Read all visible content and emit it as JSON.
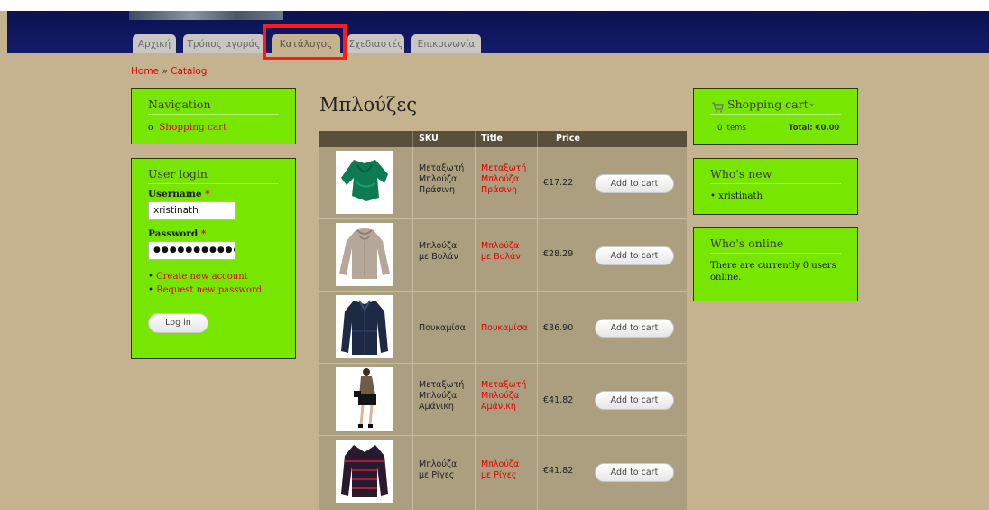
{
  "tabs": [
    {
      "label": "Αρχική"
    },
    {
      "label": "Τρόπος αγοράς"
    },
    {
      "label": "Κατάλογος"
    },
    {
      "label": "Σχεδιαστές"
    },
    {
      "label": "Επικοινωνία"
    }
  ],
  "breadcrumb": {
    "home": "Home",
    "separator": "»",
    "current": "Catalog"
  },
  "navigation": {
    "title": "Navigation",
    "items": [
      {
        "label": "Shopping cart"
      }
    ]
  },
  "login": {
    "title": "User login",
    "username_label": "Username",
    "username_value": "xristinath",
    "password_label": "Password",
    "password_mask": "●●●●●●●●●●●",
    "required_mark": "*",
    "links": [
      "Create new account",
      "Request new password"
    ],
    "button": "Log in"
  },
  "catalog": {
    "heading": "Μπλούζες",
    "columns": {
      "sku": "SKU",
      "title": "Title",
      "price": "Price"
    },
    "add_label": "Add to cart",
    "rows": [
      {
        "sku": [
          "Μεταξωτή",
          "Μπλούζα",
          "Πράσινη"
        ],
        "title": [
          "Μεταξωτή",
          "Μπλούζα",
          "Πράσινη"
        ],
        "price": "€17.22",
        "image": "green-silk-blouse"
      },
      {
        "sku": [
          "Μπλούζα",
          "με Βολάν"
        ],
        "title": [
          "Μπλούζα",
          "με Βολάν"
        ],
        "price": "€28.29",
        "image": "ruffle-blouse"
      },
      {
        "sku": [
          "Πουκαμίσα"
        ],
        "title": [
          "Πουκαμίσα"
        ],
        "price": "€36.90",
        "image": "navy-shirt"
      },
      {
        "sku": [
          "Μεταξωτή",
          "Μπλούζα",
          "Αμάνικη"
        ],
        "title": [
          "Μεταξωτή",
          "Μπλούζα",
          "Αμάνικη"
        ],
        "price": "€41.82",
        "image": "sleeveless-blouse"
      },
      {
        "sku": [
          "Μπλούζα",
          "με Ρίγες"
        ],
        "title": [
          "Μπλούζα",
          "με Ρίγες"
        ],
        "price": "€41.82",
        "image": "striped-blouse"
      }
    ]
  },
  "cart": {
    "title": "Shopping cart",
    "items": "0 Items",
    "total": "Total: €0.00",
    "icon": "cart-icon"
  },
  "whos_new": {
    "title": "Who's new",
    "users": [
      "xristinath"
    ]
  },
  "whos_online": {
    "title": "Who's online",
    "text": "There are currently 0 users online."
  },
  "colors": {
    "background": "#c4b38e",
    "block": "#77e600",
    "link": "#e00000",
    "header": "#0b1150",
    "highlight": "#ff1a1a"
  }
}
